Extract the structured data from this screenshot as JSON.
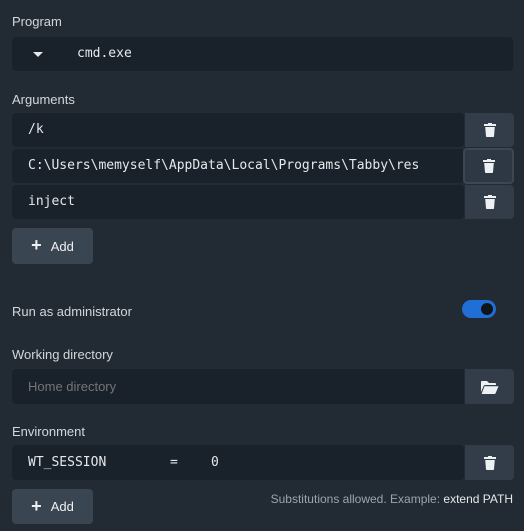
{
  "program": {
    "label": "Program",
    "value": "cmd.exe"
  },
  "arguments": {
    "label": "Arguments",
    "items": [
      "/k",
      "C:\\Users\\memyself\\AppData\\Local\\Programs\\Tabby\\res",
      "inject"
    ],
    "add_label": "Add"
  },
  "admin": {
    "label": "Run as administrator",
    "enabled": true
  },
  "working_directory": {
    "label": "Working directory",
    "placeholder": "Home directory"
  },
  "environment": {
    "label": "Environment",
    "rows": [
      {
        "key": "WT_SESSION",
        "sep": "=",
        "value": "0"
      }
    ],
    "add_label": "Add",
    "hint": "Substitutions allowed. Example:",
    "hint_example": "extend PATH"
  },
  "colors": {
    "background": "#222b34",
    "field": "#19212a",
    "accent": "#1f6fd6"
  }
}
